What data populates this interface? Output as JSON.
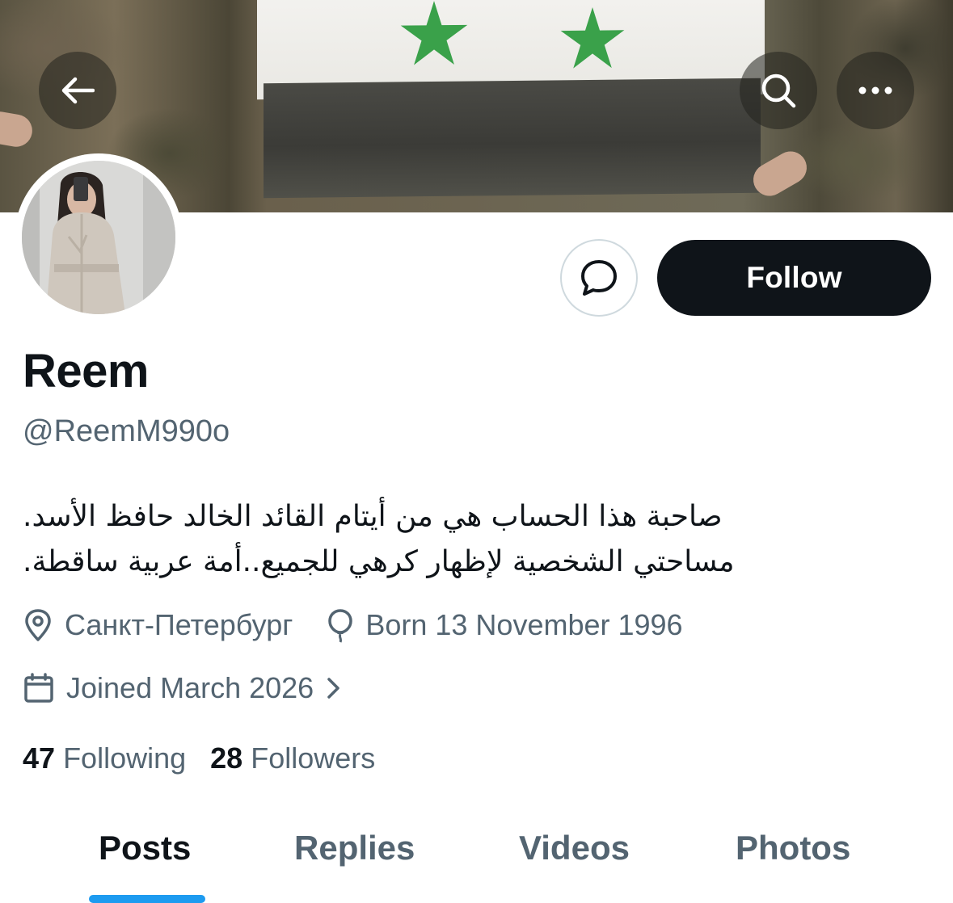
{
  "header": {
    "back_icon": "arrow-left-icon",
    "search_icon": "search-icon",
    "more_icon": "ellipsis-icon"
  },
  "profile": {
    "display_name": "Reem",
    "handle": "@ReemM990o",
    "bio_lines": [
      "صاحبة هذا الحساب هي من أيتام القائد الخالد حافظ الأسد.",
      "مساحتي الشخصية لإظهار كرهي للجميع..أمة عربية ساقطة."
    ],
    "location": "Санкт-Петербург",
    "birthday": "Born 13 November 1996",
    "joined": "Joined March 2026"
  },
  "actions": {
    "message_icon": "message-bubble-icon",
    "follow_label": "Follow"
  },
  "stats": {
    "following_count": "47",
    "following_label": "Following",
    "followers_count": "28",
    "followers_label": "Followers"
  },
  "tabs": [
    {
      "label": "Posts",
      "active": true
    },
    {
      "label": "Replies",
      "active": false
    },
    {
      "label": "Videos",
      "active": false
    },
    {
      "label": "Photos",
      "active": false
    }
  ],
  "colors": {
    "text_primary": "#0f1419",
    "text_secondary": "#536471",
    "accent": "#1d9bf0",
    "follow_bg": "#0f1419",
    "flag_star": "#3aa14a"
  }
}
